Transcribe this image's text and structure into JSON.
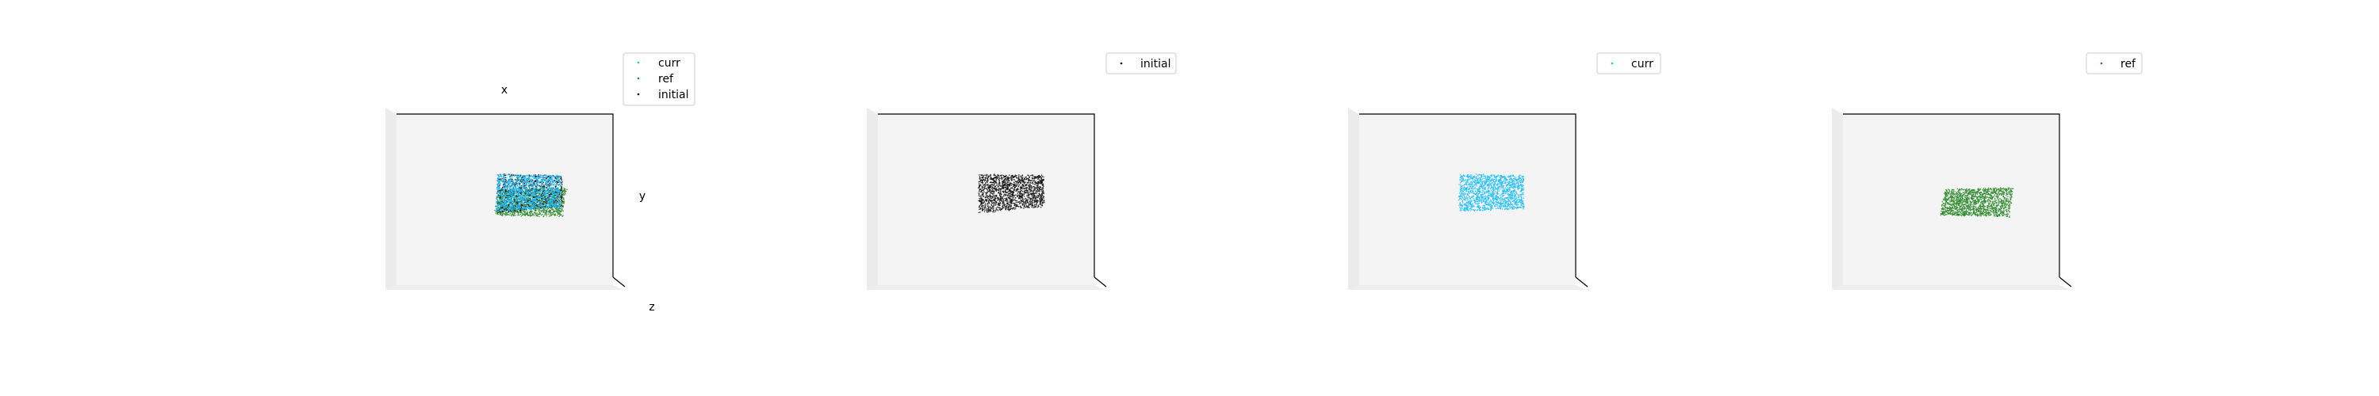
{
  "chart_data": [
    {
      "type": "scatter",
      "projection": "3d",
      "xlabel": "x",
      "ylabel": "y",
      "zlabel": "z",
      "grid": false,
      "legend_placement": "top-right",
      "legend": [
        "curr",
        "ref",
        "initial"
      ],
      "series": [
        {
          "name": "curr",
          "color": "#1fbfff",
          "shape": "sheet",
          "corners": [
            [
              -0.1,
              0.62
            ],
            [
              0.78,
              0.6
            ],
            [
              0.78,
              0.12
            ],
            [
              -0.12,
              0.08
            ]
          ],
          "point_count": 1400
        },
        {
          "name": "ref",
          "color": "#2e8b2e",
          "shape": "sheet",
          "corners": [
            [
              -0.08,
              0.4
            ],
            [
              0.86,
              0.42
            ],
            [
              0.8,
              0.0
            ],
            [
              -0.15,
              0.02
            ]
          ],
          "point_count": 1400
        },
        {
          "name": "initial",
          "color": "#111111",
          "shape": "sheet",
          "corners": [
            [
              -0.1,
              0.62
            ],
            [
              0.8,
              0.6
            ],
            [
              0.8,
              0.15
            ],
            [
              -0.1,
              0.05
            ]
          ],
          "point_count": 900
        }
      ]
    },
    {
      "type": "scatter",
      "projection": "3d",
      "grid": false,
      "legend_placement": "top-right",
      "legend": [
        "initial"
      ],
      "series": [
        {
          "name": "initial",
          "color": "#111111",
          "shape": "sheet",
          "corners": [
            [
              -0.1,
              0.62
            ],
            [
              0.8,
              0.6
            ],
            [
              0.8,
              0.15
            ],
            [
              -0.1,
              0.05
            ]
          ],
          "point_count": 1500
        }
      ]
    },
    {
      "type": "scatter",
      "projection": "3d",
      "grid": false,
      "legend_placement": "top-right",
      "legend": [
        "curr"
      ],
      "series": [
        {
          "name": "curr",
          "color": "#1fbfff",
          "shape": "sheet",
          "corners": [
            [
              -0.1,
              0.62
            ],
            [
              0.78,
              0.6
            ],
            [
              0.78,
              0.12
            ],
            [
              -0.12,
              0.08
            ]
          ],
          "point_count": 1500
        }
      ]
    },
    {
      "type": "scatter",
      "projection": "3d",
      "grid": false,
      "legend_placement": "top-right",
      "legend": [
        "ref"
      ],
      "series": [
        {
          "name": "ref",
          "color": "#2e8b2e",
          "shape": "sheet",
          "corners": [
            [
              -0.08,
              0.4
            ],
            [
              0.86,
              0.42
            ],
            [
              0.8,
              0.0
            ],
            [
              -0.15,
              0.02
            ]
          ],
          "point_count": 1500
        }
      ]
    }
  ]
}
